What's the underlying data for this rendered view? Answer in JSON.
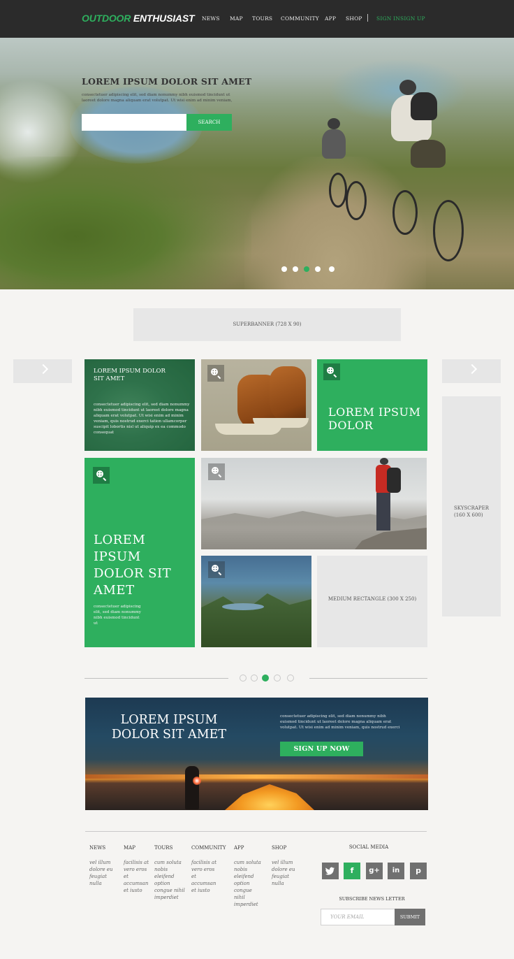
{
  "header": {
    "logo_part1": "OUTDOOR",
    "logo_part2": "ENTHUSIAST",
    "nav": [
      "NEWS",
      "MAP",
      "TOURS",
      "COMMUNITY",
      "APP",
      "SHOP"
    ],
    "sign_in": "SIGN IN",
    "sign_up": "SIGN UP"
  },
  "hero": {
    "title": "LOREM IPSUM DOLOR SIT AMET",
    "text": "consectetuer adipiscing elit, sed diam nonummy nibh euismod tincidunt ut laoreet dolore magna aliquam erat volutpat. Ut wisi enim ad minim veniam,",
    "search_value": "",
    "search_button": "SEARCH",
    "slides": 5,
    "active_slide": 3
  },
  "ads": {
    "superbanner": "SUPERBANNER (728 X 90)",
    "skyscraper": "SKYSCRAPER (160 X 600)",
    "medium_rectangle": "MEDIUM RECTANGLE (300 X 250)"
  },
  "tiles": {
    "tile1_title": "LOREM IPSUM DOLOR SIT AMET",
    "tile1_text": "consectetuer adipiscing elit, sed diam nonummy nibh euismod tincidunt ut laoreet dolore magna aliquam erat volutpat. Ut wisi enim ad minim veniam, quis nostrud exerci tation ullamcorper suscipit lobortis nisl ut aliquip ex ea commodo consequat",
    "tile3_title": "LOREM IPSUM DOLOR",
    "tile4_title": "LOREM IPSUM DOLOR SIT AMET",
    "tile4_text": "consectetuer adipiscing elit, sed diam nonummy nibh euismod tincidunt ut"
  },
  "gallery_pager": {
    "pages": 5,
    "active_page": 3
  },
  "promo": {
    "title": "LOREM IPSUM DOLOR SIT AMET",
    "text": "consectetuer adipiscing elit, sed diam nonummy nibh euismod tincidunt ut laoreet dolore magna aliquam erat volutpat. Ut wisi enim ad minim veniam, quis nostrud exerci",
    "button": "SIGN UP NOW"
  },
  "footer": {
    "columns": [
      {
        "heading": "NEWS",
        "text": "vel illum dolore eu feugiat nulla"
      },
      {
        "heading": "MAP",
        "text": "facilisis at vero eros et accumsan et iusto"
      },
      {
        "heading": "TOURS",
        "text": "cum soluta nobis eleifend option congue nihil imperdiet"
      },
      {
        "heading": "COMMUNITY",
        "text": "facilisis at vero eros et accumsan et iusto"
      },
      {
        "heading": "APP",
        "text": "cum soluta nobis eleifend option congue nihil imperdiet"
      },
      {
        "heading": "SHOP",
        "text": "vel illum dolore eu feugiat nulla"
      }
    ],
    "social_heading": "SOCIAL MEDIA",
    "social_icons": [
      "twitter-icon",
      "facebook-icon",
      "google-plus-icon",
      "linkedin-icon",
      "pinterest-icon"
    ],
    "social_glyphs": [
      "t",
      "f",
      "g+",
      "in",
      "p"
    ],
    "subscribe_heading": "SUBSCRIBE NEWS LETTER",
    "email_placeholder": "YOUR EMAIL",
    "submit": "SUBMIT"
  },
  "colors": {
    "accent": "#2eaf5e",
    "header_bg": "#2b2b2b",
    "ad_gray": "#e7e7e7",
    "page_bg": "#f5f4f2"
  }
}
